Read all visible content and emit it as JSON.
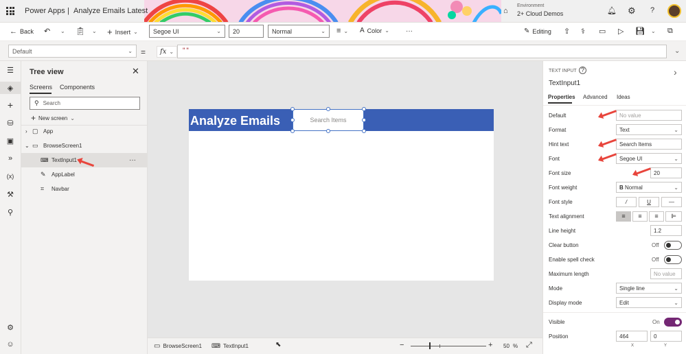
{
  "app": {
    "brand": "Power Apps",
    "separator": "|",
    "app_name": "Analyze Emails Latest",
    "environment_label": "Environment",
    "environment_name": "2+ Cloud Demos"
  },
  "toolbar": {
    "back_label": "Back",
    "insert_label": "Insert",
    "font_value": "Segoe UI",
    "font_size_value": "20",
    "weight_value": "Normal",
    "color_label": "Color",
    "more_label": "···",
    "editing_label": "Editing"
  },
  "formula": {
    "property_value": "Default",
    "equals": "=",
    "fx_label": "fx",
    "formula_text": "\"\""
  },
  "tree": {
    "title": "Tree view",
    "tabs": [
      "Screens",
      "Components"
    ],
    "search_placeholder": "Search",
    "new_screen_label": "New screen",
    "items": [
      {
        "label": "App"
      },
      {
        "label": "BrowseScreen1"
      },
      {
        "label": "TextInput1",
        "more": "···"
      },
      {
        "label": "AppLabel"
      },
      {
        "label": "Navbar"
      }
    ]
  },
  "canvas": {
    "header_title": "Analyze Emails",
    "search_hint": "Search Items",
    "header_color": "#3a5fb5"
  },
  "statusbar": {
    "screen_crumb": "BrowseScreen1",
    "control_crumb": "TextInput1",
    "zoom_minus": "−",
    "zoom_plus": "+",
    "zoom_value": "50",
    "zoom_unit": "%",
    "zoom_level": 0.5
  },
  "props": {
    "control_type": "TEXT INPUT",
    "control_name": "TextInput1",
    "tabs": [
      "Properties",
      "Advanced",
      "Ideas"
    ],
    "rows": {
      "default": {
        "label": "Default",
        "placeholder": "No value"
      },
      "format": {
        "label": "Format",
        "value": "Text"
      },
      "hint_text": {
        "label": "Hint text",
        "value": "Search Items"
      },
      "font": {
        "label": "Font",
        "value": "Segoe UI"
      },
      "font_size": {
        "label": "Font size",
        "value": "20"
      },
      "font_weight": {
        "label": "Font weight",
        "value": "Normal",
        "icon": "B"
      },
      "font_style": {
        "label": "Font style",
        "italic": "/",
        "underline": "U",
        "strike": "—"
      },
      "text_alignment": {
        "label": "Text alignment"
      },
      "line_height": {
        "label": "Line height",
        "value": "1.2"
      },
      "clear_button": {
        "label": "Clear button",
        "state": "Off"
      },
      "spell_check": {
        "label": "Enable spell check",
        "state": "Off"
      },
      "max_length": {
        "label": "Maximum length",
        "placeholder": "No value"
      },
      "mode": {
        "label": "Mode",
        "value": "Single line"
      },
      "display_mode": {
        "label": "Display mode",
        "value": "Edit"
      },
      "visible": {
        "label": "Visible",
        "state": "On"
      },
      "position": {
        "label": "Position",
        "x": "464",
        "y": "0",
        "x_label": "X",
        "y_label": "Y"
      }
    }
  },
  "colors": {
    "accent": "#742774",
    "arrow": "#e8453c",
    "selection": "#edebe9"
  }
}
